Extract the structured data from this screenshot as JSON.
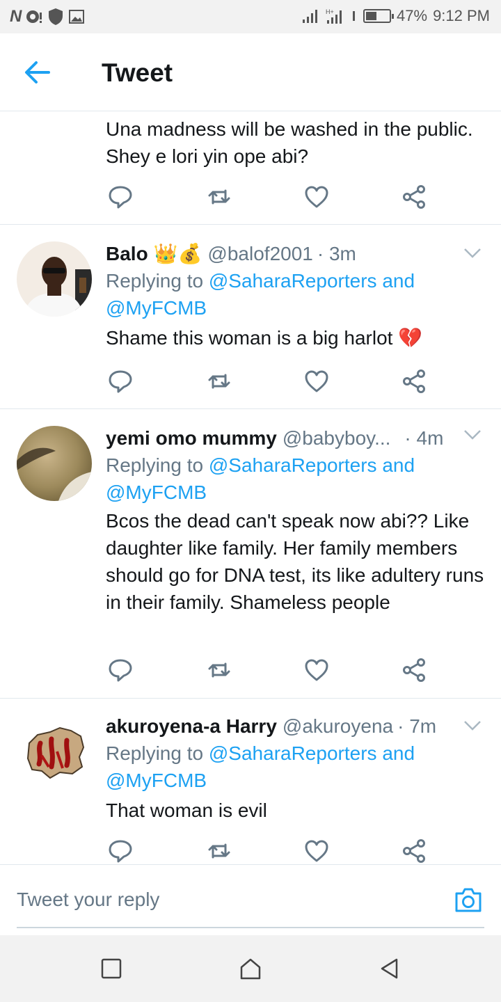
{
  "status_bar": {
    "left_letter": "N",
    "battery_percent": "47%",
    "battery_level": 0.47,
    "time": "9:12 PM"
  },
  "header": {
    "title": "Tweet"
  },
  "tweets": [
    {
      "text": "Una madness will be washed in the public. Shey e lori yin ope abi?"
    },
    {
      "name": "Balo",
      "emoji": "👑💰",
      "handle": "@balof2001",
      "time": "· 3m",
      "replying_prefix": "Replying to",
      "mention1": "@SaharaReporters",
      "and": "and",
      "mention2": "@MyFCMB",
      "text": "Shame this woman is a big harlot 💔"
    },
    {
      "name": "yemi omo mummy",
      "handle": "@babyboy...",
      "time": "· 4m",
      "replying_prefix": "Replying to",
      "mention1": "@SaharaReporters",
      "and": "and",
      "mention2": "@MyFCMB",
      "text": "Bcos the dead can't speak now abi?? Like daughter like family. Her family members should go for DNA test, its like adultery runs in their family. Shameless people"
    },
    {
      "name": "akuroyena-a Harry",
      "handle": "@akuroyena",
      "time": "· 7m",
      "replying_prefix": "Replying to",
      "mention1": "@SaharaReporters",
      "and": "and",
      "mention2": "@MyFCMB",
      "text": "That woman is evil"
    }
  ],
  "reply_bar": {
    "placeholder": "Tweet your reply"
  },
  "colors": {
    "accent": "#1da1f2",
    "secondary_text": "#657786",
    "divider": "#e1e8ed",
    "icon_gray": "#657786"
  }
}
